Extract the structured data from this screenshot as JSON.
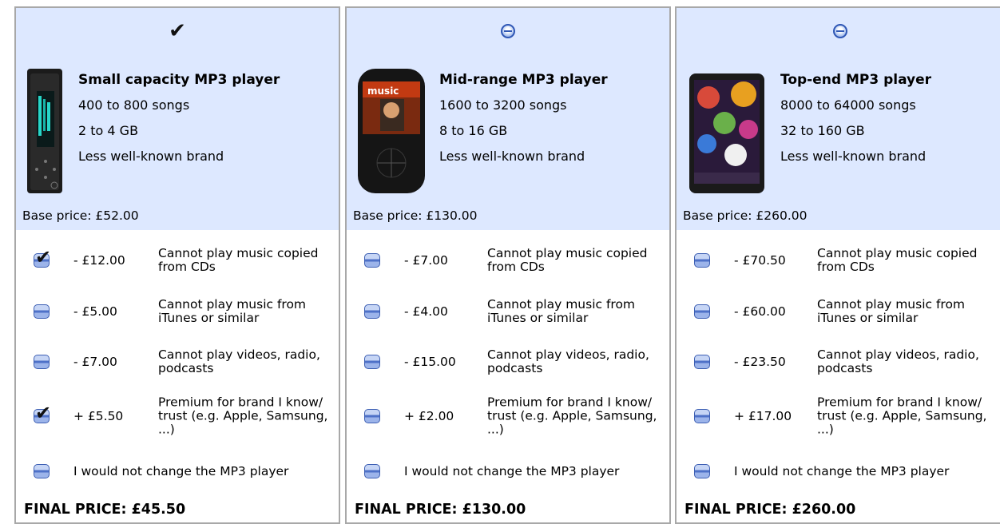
{
  "columns": [
    {
      "selected": true,
      "title": "Small capacity MP3 player",
      "specs": [
        "400 to 800 songs",
        "2 to 4 GB",
        "Less well-known brand"
      ],
      "base_price": "Base price: £52.00",
      "options": [
        {
          "amount": "- £12.00",
          "text": "Cannot play music copied from CDs",
          "checked": true
        },
        {
          "amount": "- £5.00",
          "text": "Cannot play music from iTunes or similar",
          "checked": false
        },
        {
          "amount": "- £7.00",
          "text": "Cannot play videos, radio, podcasts",
          "checked": false
        },
        {
          "amount": "+ £5.50",
          "text": "Premium for brand I know/ trust (e.g. Apple, Samsung, ...)",
          "checked": true
        }
      ],
      "no_change": "I would not change the MP3 player",
      "final_price": "FINAL PRICE: £45.50"
    },
    {
      "selected": false,
      "title": "Mid-range MP3 player",
      "specs": [
        "1600 to 3200 songs",
        "8 to 16 GB",
        "Less well-known brand"
      ],
      "base_price": "Base price: £130.00",
      "options": [
        {
          "amount": "- £7.00",
          "text": "Cannot play music copied from CDs",
          "checked": false
        },
        {
          "amount": "- £4.00",
          "text": "Cannot play music from iTunes or similar",
          "checked": false
        },
        {
          "amount": "- £15.00",
          "text": "Cannot play videos, radio, podcasts",
          "checked": false
        },
        {
          "amount": "+ £2.00",
          "text": "Premium for brand I know/ trust (e.g. Apple, Samsung, ...)",
          "checked": false
        }
      ],
      "no_change": "I would not change the MP3 player",
      "final_price": "FINAL PRICE: £130.00"
    },
    {
      "selected": false,
      "title": "Top-end MP3 player",
      "specs": [
        "8000 to 64000 songs",
        "32 to 160 GB",
        "Less well-known brand"
      ],
      "base_price": "Base price: £260.00",
      "options": [
        {
          "amount": "- £70.50",
          "text": "Cannot play music copied from CDs",
          "checked": false
        },
        {
          "amount": "- £60.00",
          "text": "Cannot play music from iTunes or similar",
          "checked": false
        },
        {
          "amount": "- £23.50",
          "text": "Cannot play videos, radio, podcasts",
          "checked": false
        },
        {
          "amount": "+ £17.00",
          "text": "Premium for brand I know/ trust (e.g. Apple, Samsung, ...)",
          "checked": false
        }
      ],
      "no_change": "I would not change the MP3 player",
      "final_price": "FINAL PRICE: £260.00"
    }
  ],
  "player_screen_text": "music",
  "colors": {
    "header_bg": "#dde8ff",
    "border": "#a8a8a8",
    "control_blue": "#4e71c8"
  }
}
